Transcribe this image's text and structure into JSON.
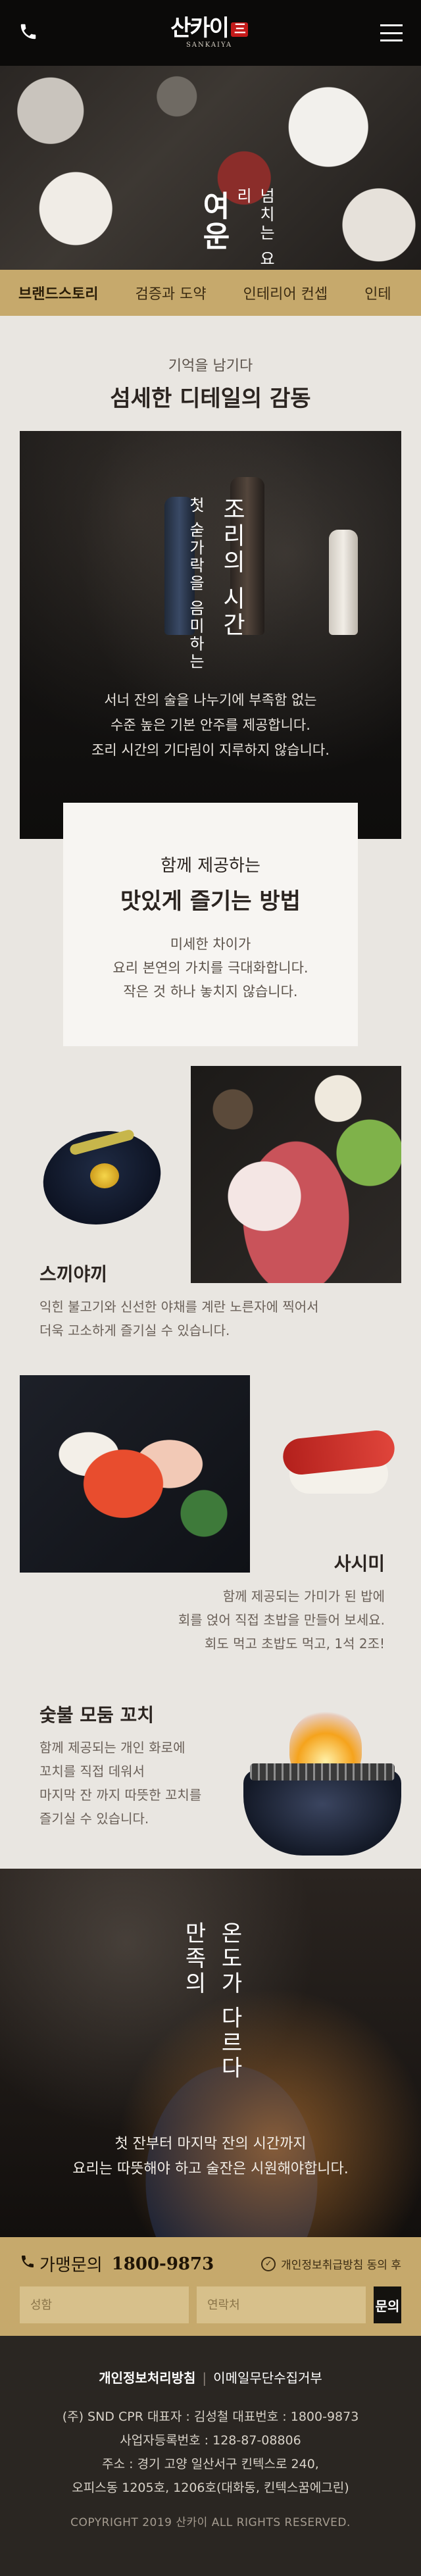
{
  "header": {
    "logo_text": "산카이",
    "logo_badge": "三",
    "logo_sub": "SANKAIYA"
  },
  "hero": {
    "title": "여운",
    "subtitle": "넘치는 요리"
  },
  "nav": {
    "items": [
      "브랜드스토리",
      "검증과 도약",
      "인테리어 컨셉",
      "인테"
    ]
  },
  "intro": {
    "small": "기억을 남기다",
    "big": "섬세한 디테일의 감동"
  },
  "cooking": {
    "subtitle": "첫 숟가락을 음미하는",
    "title": "조리의 시간",
    "desc": [
      "서너 잔의 술을 나누기에 부족함 없는",
      "수준 높은 기본 안주를 제공합니다.",
      "조리 시간의 기다림이 지루하지 않습니다."
    ]
  },
  "method": {
    "small": "함께 제공하는",
    "big": "맛있게 즐기는 방법",
    "desc": [
      "미세한 차이가",
      "요리 본연의 가치를 극대화합니다.",
      "작은 것 하나 놓치지 않습니다."
    ]
  },
  "sukiyaki": {
    "title": "스끼야끼",
    "desc": [
      "익힌 불고기와 신선한 야채를 계란 노른자에 찍어서",
      "더욱 고소하게 즐기실 수 있습니다."
    ]
  },
  "sashimi": {
    "title": "사시미",
    "desc": [
      "함께 제공되는 가미가 된 밥에",
      "회를 얹어 직접 초밥을 만들어 보세요.",
      "회도 먹고 초밥도 먹고, 1석 2조!"
    ]
  },
  "skewer": {
    "title": "숯불 모둠 꼬치",
    "desc": [
      "함께 제공되는 개인 화로에",
      "꼬치를 직접 데워서",
      "마지막 잔 까지 따뜻한 꼬치를",
      "즐기실 수 있습니다."
    ]
  },
  "satisfaction": {
    "line_a": "만족의",
    "line_b": "온도가 다르다",
    "desc": [
      "첫 잔부터 마지막 잔의 시간까지",
      "요리는 따뜻해야 하고 술잔은 시원해야합니다."
    ]
  },
  "franchise": {
    "label": "가맹문의",
    "phone": "1800-9873",
    "agree_label": "개인정보취급방침 동의 후",
    "name_placeholder": "성함",
    "contact_placeholder": "연락처",
    "submit_label": "문의"
  },
  "footer": {
    "privacy_link": "개인정보처리방침",
    "email_link": "이메일무단수집거부",
    "company_line": "(주) SND CPR   대표자 : 김성철   대표번호 : 1800-9873",
    "biz_line": "사업자등록번호 : 128-87-08806",
    "addr_line1": "주소 : 경기 고양 일산서구 킨텍스로 240,",
    "addr_line2": "오피스동 1205호, 1206호(대화동, 킨텍스꿈에그린)",
    "copyright": "COPYRIGHT 2019 산카이 ALL RIGHTS RESERVED."
  },
  "colors": {
    "gold": "#c6a96c",
    "dark": "#0b0a09",
    "footer_bg": "#2a2622",
    "logo_red": "#c41a1a"
  },
  "icons": {
    "phone": "phone-icon",
    "menu": "hamburger-menu-icon",
    "check": "check-circle-icon"
  }
}
